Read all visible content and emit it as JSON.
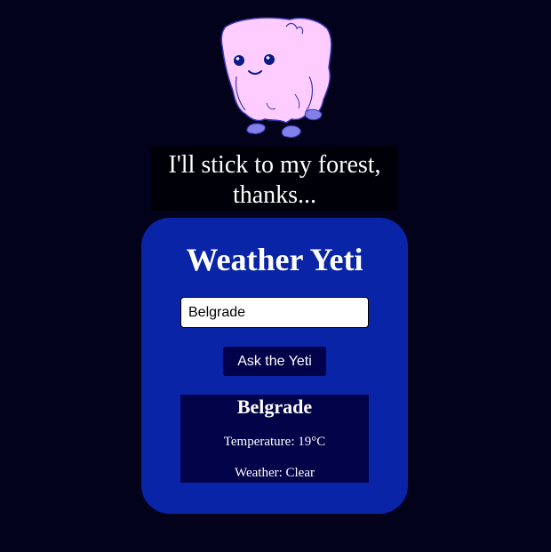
{
  "mascot": {
    "speech": "I'll stick to my forest, thanks...",
    "fur_color": "#ffccff",
    "outline_color": "#3a3ab8"
  },
  "app": {
    "title": "Weather Yeti"
  },
  "search": {
    "value": "Belgrade",
    "button_label": "Ask the Yeti"
  },
  "result": {
    "city": "Belgrade",
    "temperature_text": "Temperature: 19°C",
    "weather_text": "Weather: Clear"
  },
  "colors": {
    "background": "#02021a",
    "card": "#0a24a8",
    "button": "#02024a",
    "result_panel": "#03034a"
  }
}
